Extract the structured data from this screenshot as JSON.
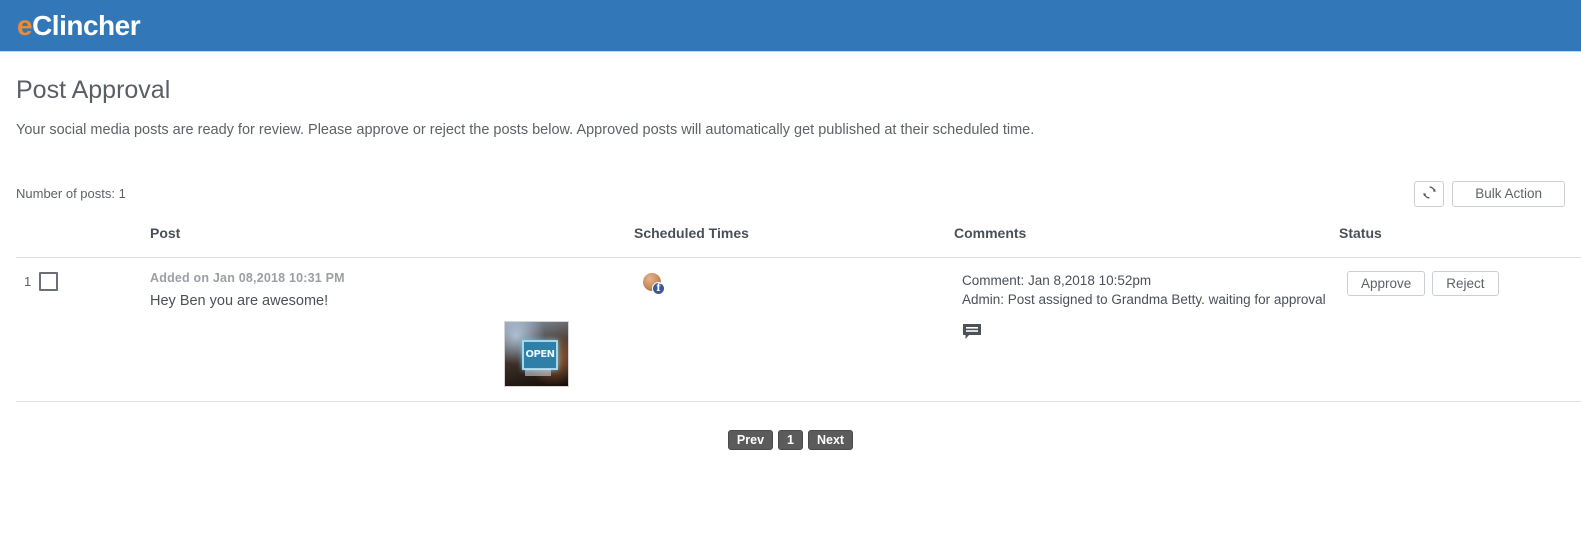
{
  "brand": {
    "logo_accent": "e",
    "logo_text": "Clincher",
    "accent_color": "#f08a2c",
    "bar_color": "#3278b8"
  },
  "page": {
    "title": "Post Approval",
    "subtitle": "Your social media posts are ready for review. Please approve or reject the posts below. Approved posts will automatically get published at their scheduled time."
  },
  "toolbar": {
    "posts_count_label": "Number of posts: 1",
    "refresh_icon": "refresh-icon",
    "bulk_action_label": "Bulk Action"
  },
  "table": {
    "headers": {
      "post": "Post",
      "scheduled": "Scheduled Times",
      "comments": "Comments",
      "status": "Status"
    },
    "rows": [
      {
        "index": "1",
        "added_on": "Added on Jan 08,2018 10:31 PM",
        "text": "Hey Ben you are awesome!",
        "thumbnail_alt": "OPEN",
        "network_icon": "facebook-icon",
        "comment_timestamp": "Comment: Jan 8,2018 10:52pm",
        "comment_body": "Admin: Post assigned to Grandma Betty. waiting for approval",
        "comment_icon": "comment-icon",
        "approve_label": "Approve",
        "reject_label": "Reject"
      }
    ]
  },
  "pagination": {
    "prev_label": "Prev",
    "current_page": "1",
    "next_label": "Next"
  }
}
